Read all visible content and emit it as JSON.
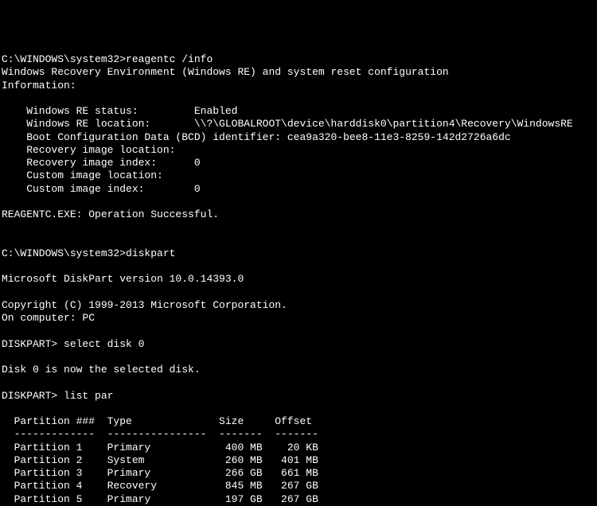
{
  "prompt1": "C:\\WINDOWS\\system32>",
  "cmd1": "reagentc /info",
  "header1": "Windows Recovery Environment (Windows RE) and system reset configuration",
  "header2": "Information:",
  "info": {
    "status_label": "    Windows RE status:         ",
    "status_value": "Enabled",
    "location_label": "    Windows RE location:       ",
    "location_value": "\\\\?\\GLOBALROOT\\device\\harddisk0\\partition4\\Recovery\\WindowsRE",
    "bcd_line": "    Boot Configuration Data (BCD) identifier: cea9a320-bee8-11e3-8259-142d2726a6dc",
    "recovery_loc": "    Recovery image location:",
    "recovery_idx_label": "    Recovery image index:      ",
    "recovery_idx_value": "0",
    "custom_loc": "    Custom image location:",
    "custom_idx_label": "    Custom image index:        ",
    "custom_idx_value": "0"
  },
  "success": "REAGENTC.EXE: Operation Successful.",
  "prompt2": "C:\\WINDOWS\\system32>",
  "cmd2": "diskpart",
  "dp_version": "Microsoft DiskPart version 10.0.14393.0",
  "dp_copyright": "Copyright (C) 1999-2013 Microsoft Corporation.",
  "dp_computer": "On computer: PC",
  "dp_prompt1": "DISKPART> ",
  "dp_cmd1": "select disk 0",
  "dp_result1": "Disk 0 is now the selected disk.",
  "dp_prompt2": "DISKPART> ",
  "dp_cmd2": "list par",
  "table": {
    "header": "  Partition ###  Type              Size     Offset",
    "divider": "  -------------  ----------------  -------  -------",
    "rows": [
      "  Partition 1    Primary            400 MB    20 KB",
      "  Partition 2    System             260 MB   401 MB",
      "  Partition 3    Primary            266 GB   661 MB",
      "  Partition 4    Recovery           845 MB   267 GB",
      "  Partition 5    Primary            197 GB   267 GB"
    ]
  }
}
